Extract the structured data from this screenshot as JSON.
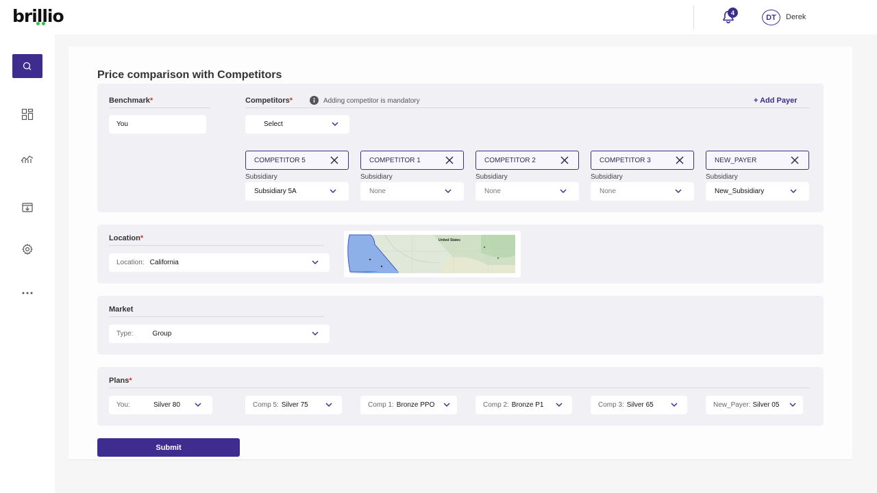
{
  "header": {
    "notification_count": "4",
    "avatar_initials": "DT",
    "username": "Derek"
  },
  "brand": {
    "logo_text": "brillio",
    "accent": "#3e2d8f",
    "dots_color": "#2fbf4f"
  },
  "sidebar": {
    "items": [
      {
        "icon": "search-icon",
        "active": true
      },
      {
        "icon": "dashboard-icon",
        "active": false
      },
      {
        "icon": "analytics-icon",
        "active": false
      },
      {
        "icon": "download-box-icon",
        "active": false
      },
      {
        "icon": "gear-icon",
        "active": false
      },
      {
        "icon": "more-icon",
        "active": false
      }
    ]
  },
  "page": {
    "title": "Price comparison with Competitors"
  },
  "competitors_section": {
    "benchmark_label": "Benchmark",
    "benchmark_value": "You",
    "competitors_label": "Competitors",
    "info_text": "Adding competitor is mandatory",
    "add_payer": "+ Add Payer",
    "select_placeholder": "Select",
    "subsidiary_label": "Subsidiary",
    "chips": [
      {
        "name": "COMPETITOR 5",
        "subsidiary": "Subsidiary 5A"
      },
      {
        "name": "COMPETITOR 1",
        "subsidiary": "None"
      },
      {
        "name": "COMPETITOR 2",
        "subsidiary": "None"
      },
      {
        "name": "COMPETITOR 3",
        "subsidiary": "None"
      },
      {
        "name": "NEW_PAYER",
        "subsidiary": "New_Subsidiary"
      }
    ]
  },
  "location_section": {
    "label": "Location",
    "prefix": "Location:",
    "value": "California",
    "map_country_label": "United States"
  },
  "market_section": {
    "label": "Market",
    "prefix": "Type:",
    "value": "Group"
  },
  "plans_section": {
    "label": "Plans",
    "plans": [
      {
        "prefix": "You:",
        "value": "Silver 80"
      },
      {
        "prefix": "Comp 5:",
        "value": "Silver 75"
      },
      {
        "prefix": "Comp 1:",
        "value": "Bronze PPO"
      },
      {
        "prefix": "Comp 2:",
        "value": "Bronze P1"
      },
      {
        "prefix": "Comp 3:",
        "value": "Silver 65"
      },
      {
        "prefix": "New_Payer:",
        "value": "Silver 05"
      }
    ]
  },
  "submit_label": "Submit"
}
